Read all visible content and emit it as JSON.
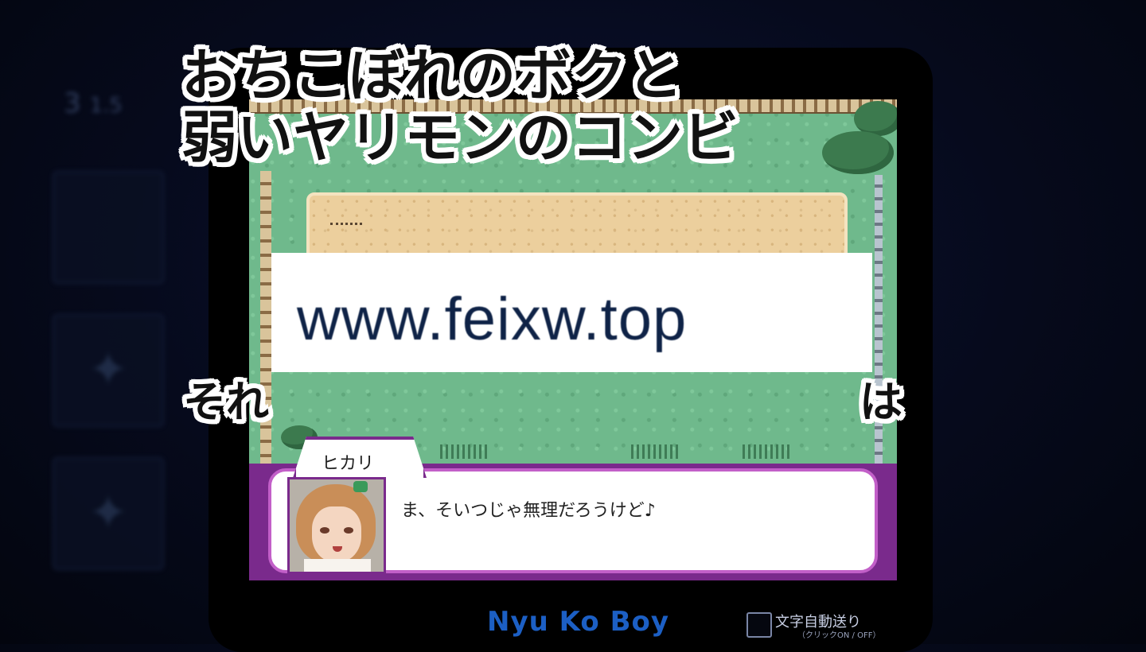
{
  "left_panel": {
    "stat_main": "3",
    "stat_sub": "1.5"
  },
  "captions": {
    "line1": "おちこぼれのボクと",
    "line2": "弱いヤリモンのコンビ",
    "line3_start": "それ",
    "line3_end": "は"
  },
  "watermark": {
    "text": "www.feixw.top"
  },
  "dialog": {
    "speaker": "ヒカリ",
    "message": "ま、そいつじゃ無理だろうけど♪"
  },
  "device": {
    "brand": "Nyu Ko Boy"
  },
  "auto_advance": {
    "label": "文字自動送り",
    "hint": "（クリックON / OFF）",
    "checked": false
  },
  "colors": {
    "brand": "#1c5fc4",
    "dialog_frame": "#7a2a8c",
    "dialog_border": "#c25fc8",
    "grass": "#6fb98c",
    "sand": "#eccf9d"
  },
  "icons": [
    "star-icon",
    "star-icon"
  ]
}
